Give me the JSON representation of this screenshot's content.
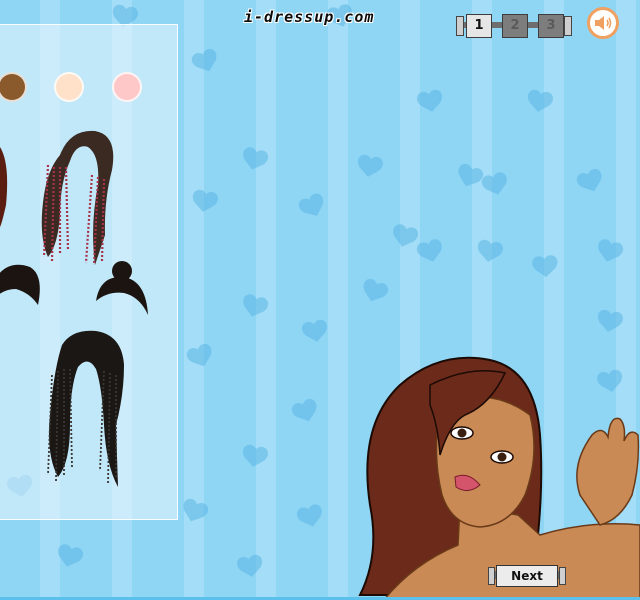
{
  "site": {
    "brand": "i-dressup.com"
  },
  "pager": {
    "pages": [
      "1",
      "2",
      "3"
    ],
    "active": "1"
  },
  "sound": {
    "icon": "speaker-icon"
  },
  "panel": {
    "swatches": [
      {
        "name": "brown-hair-color",
        "color": "#8a5a2c"
      },
      {
        "name": "peach-hair-color",
        "color": "#ffe0c8"
      },
      {
        "name": "pink-hair-color",
        "color": "#ffc8c8"
      }
    ],
    "hair_options": [
      "partial-hairstyle",
      "red-braids-hairstyle",
      "short-hairstyle",
      "bun-hairstyle",
      "long-black-braids-hairstyle"
    ]
  },
  "buttons": {
    "next_label": "Next"
  },
  "colors": {
    "background": "#8fd6f5",
    "accent": "#f0a060",
    "hair": "#6b2a1a",
    "skin": "#c98a56"
  }
}
